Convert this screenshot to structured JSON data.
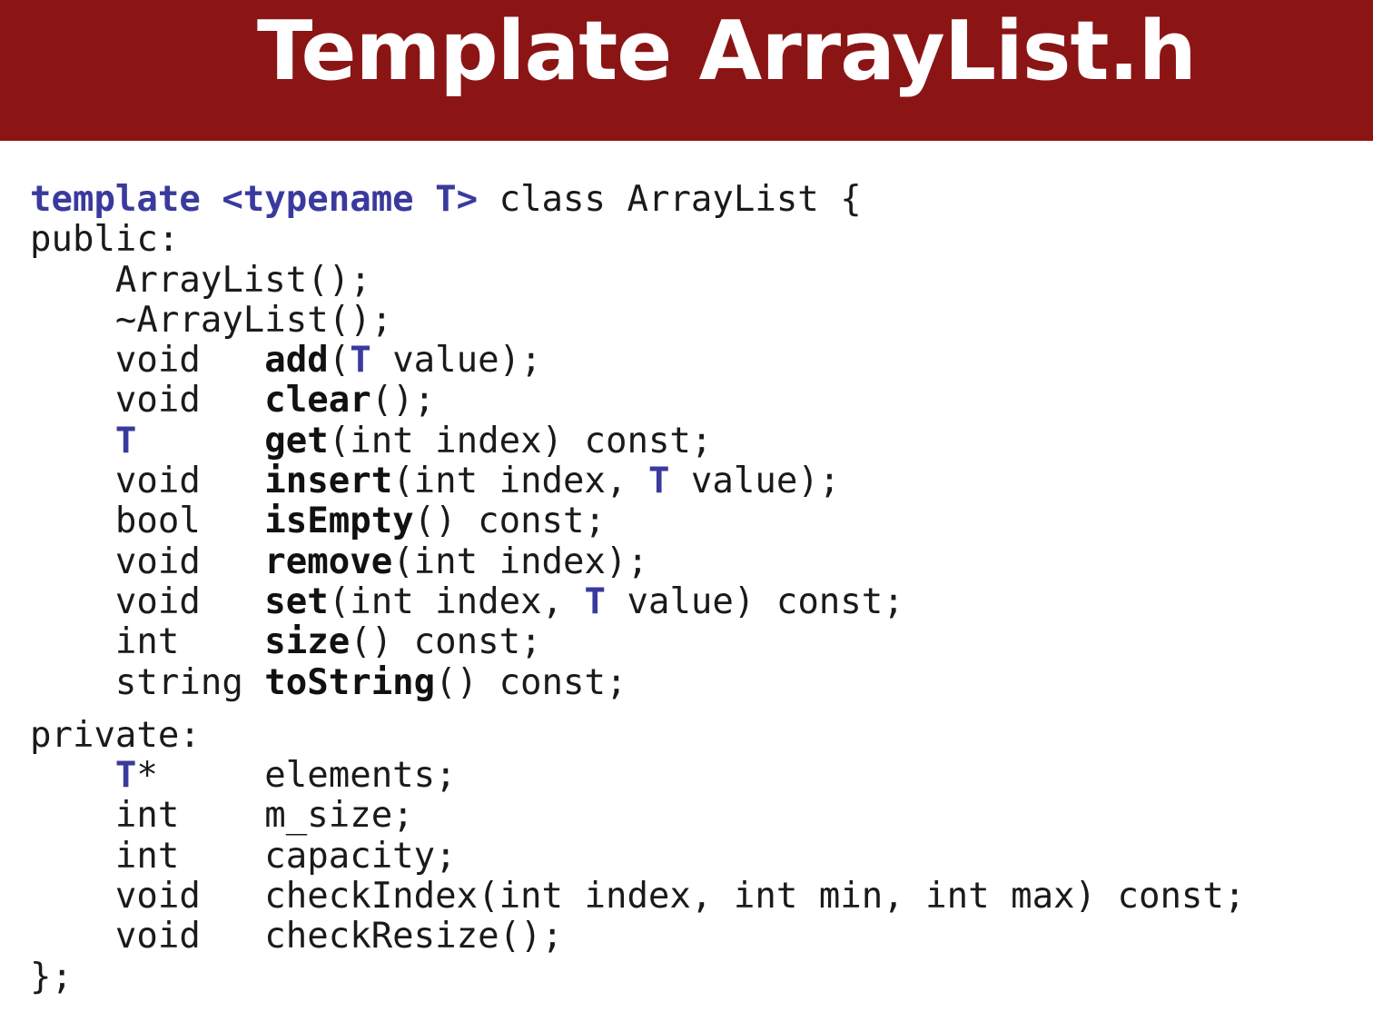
{
  "slide": {
    "title": "Template ArrayList.h"
  },
  "code": {
    "decl": {
      "kw_template": "template",
      "kw_typename": "<typename",
      "tparam": "T>",
      "rest": " class ArrayList {"
    },
    "public_label": "public:",
    "ctor": "ArrayList();",
    "dtor": "~ArrayList();",
    "add": {
      "ret": "void",
      "name": "add",
      "a": "(",
      "t": "T",
      "b": " value);"
    },
    "clear": {
      "ret": "void",
      "name": "clear",
      "rest": "();"
    },
    "get": {
      "ret": "T",
      "name": "get",
      "rest": "(int index) const;"
    },
    "insert": {
      "ret": "void",
      "name": "insert",
      "a": "(int index, ",
      "t": "T",
      "b": " value);"
    },
    "isEmpty": {
      "ret": "bool",
      "name": "isEmpty",
      "rest": "() const;"
    },
    "remove": {
      "ret": "void",
      "name": "remove",
      "rest": "(int index);"
    },
    "set": {
      "ret": "void",
      "name": "set",
      "a": "(int index, ",
      "t": "T",
      "b": " value) const;"
    },
    "size": {
      "ret": "int",
      "name": "size",
      "rest": "() const;"
    },
    "toString": {
      "ret": "string",
      "name": "toString",
      "rest": "() const;"
    },
    "private_label": "private:",
    "elements": {
      "t": "T",
      "star": "*",
      "name": "elements;"
    },
    "m_size": {
      "type": "int",
      "name": "m_size;"
    },
    "capacity": {
      "type": "int",
      "name": "capacity;"
    },
    "checkIndex": {
      "type": "void",
      "name": "checkIndex(int index, int min, int max) const;"
    },
    "checkResize": {
      "type": "void",
      "name": "checkResize();"
    },
    "closing": "};"
  },
  "colors": {
    "header_bg": "#8b1515",
    "keyword": "#3a3a9e"
  }
}
